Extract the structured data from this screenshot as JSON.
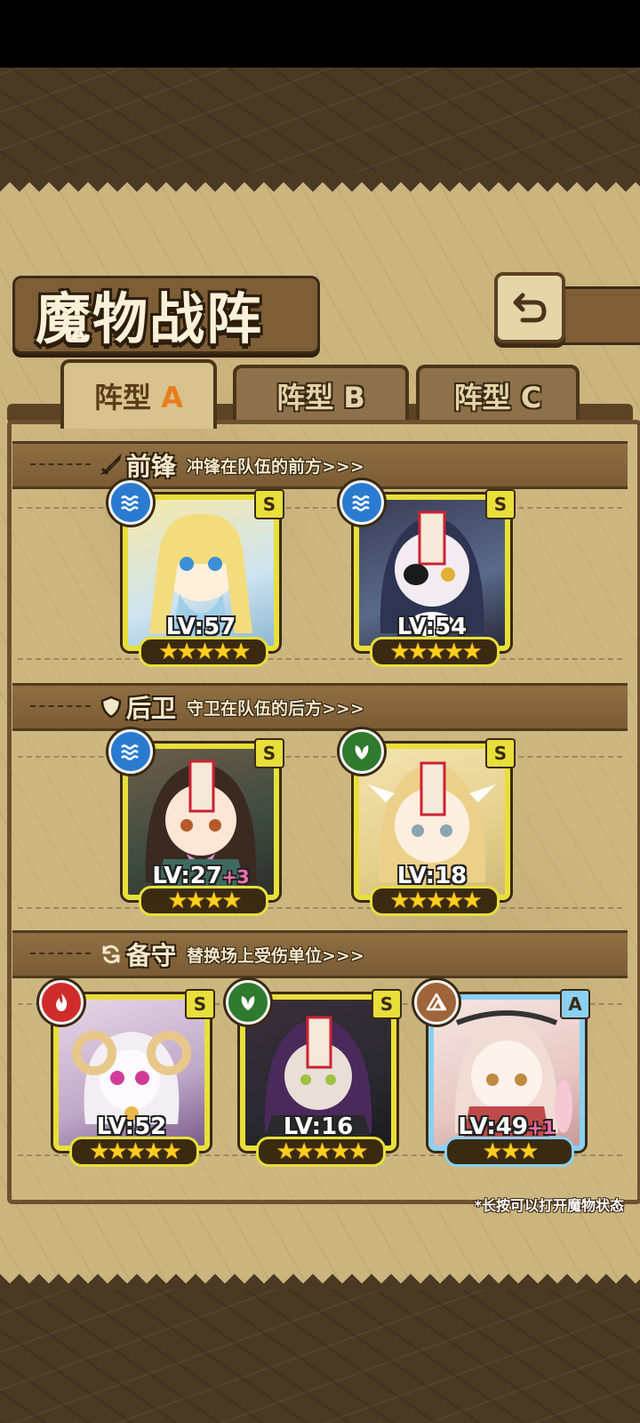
{
  "header": {
    "title": "魔物战阵",
    "back_icon": "back-arrow-icon"
  },
  "tabs": [
    {
      "label_main": "阵型",
      "label_letter": "A",
      "active": true
    },
    {
      "label_main": "阵型",
      "label_letter": "B",
      "active": false
    },
    {
      "label_main": "阵型",
      "label_letter": "C",
      "active": false
    }
  ],
  "sections": {
    "front": {
      "title": "前锋",
      "subtitle": "冲锋在队伍的前方>>>"
    },
    "back": {
      "title": "后卫",
      "subtitle": "守卫在队伍的后方>>>"
    },
    "reserve": {
      "title": "备守",
      "subtitle": "替换场上受伤单位>>>"
    }
  },
  "cards": {
    "front1": {
      "level": "LV:57",
      "bonus": "",
      "rarity": "S",
      "element": "water",
      "stars": "★★★★★"
    },
    "front2": {
      "level": "LV:54",
      "bonus": "",
      "rarity": "S",
      "element": "water",
      "stars": "★★★★★"
    },
    "back1": {
      "level": "LV:27",
      "bonus": "+3",
      "rarity": "S",
      "element": "water",
      "stars": "★★★★"
    },
    "back2": {
      "level": "LV:18",
      "bonus": "",
      "rarity": "S",
      "element": "grass",
      "stars": "★★★★★"
    },
    "res1": {
      "level": "LV:52",
      "bonus": "",
      "rarity": "S",
      "element": "fire",
      "stars": "★★★★★"
    },
    "res2": {
      "level": "LV:16",
      "bonus": "",
      "rarity": "S",
      "element": "grass",
      "stars": "★★★★★"
    },
    "res3": {
      "level": "LV:49",
      "bonus": "+1",
      "rarity": "A",
      "element": "earth",
      "stars": "★★★"
    }
  },
  "hint": "*长按可以打开魔物状态",
  "colors": {
    "frame_gold": "#e8df3a",
    "frame_blue": "#8ad0f2",
    "panel": "#cbb57e"
  }
}
